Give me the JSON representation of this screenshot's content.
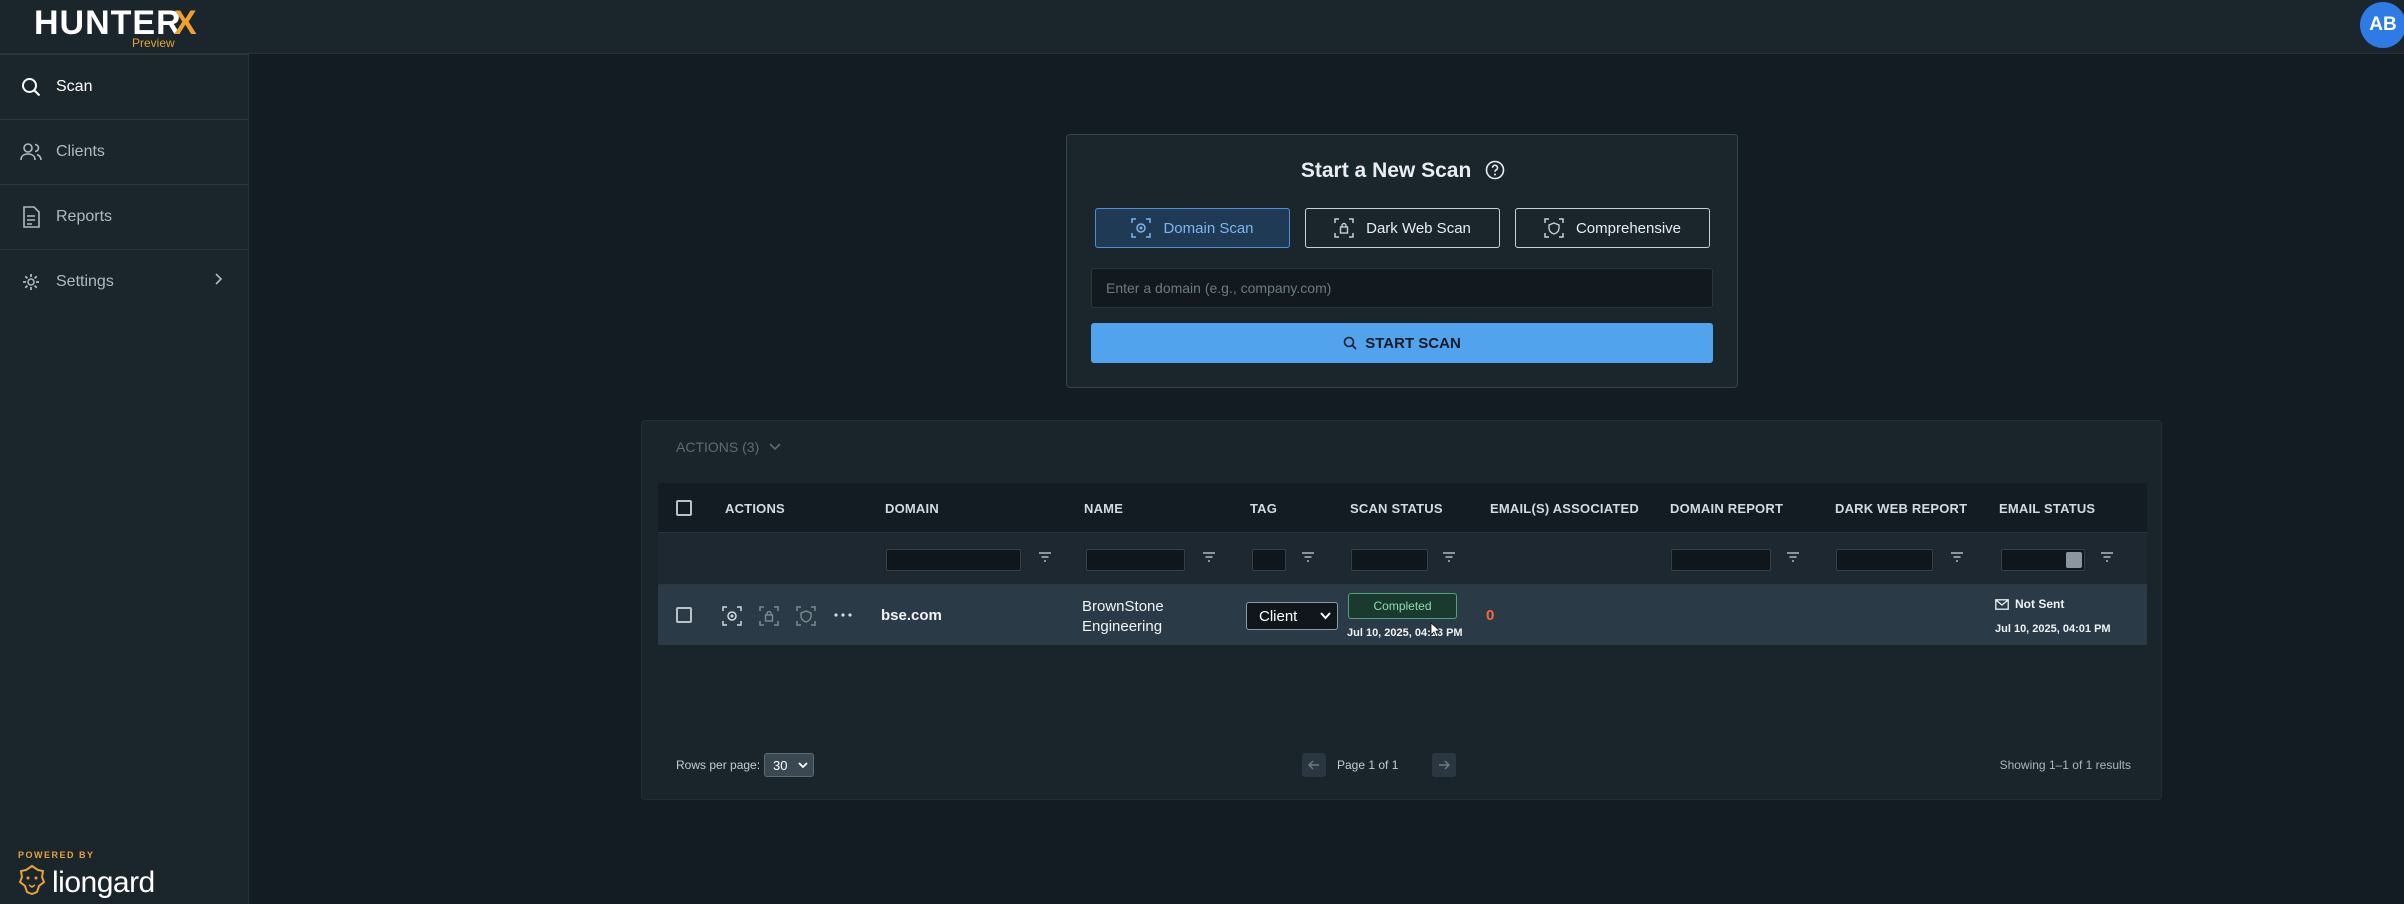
{
  "app": {
    "logo_text": "HUNTER",
    "logo_x": "X",
    "logo_badge": "Preview",
    "user_initials": "AB",
    "brand_accent": "#f0a030"
  },
  "sidebar": {
    "items": [
      {
        "label": "Scan",
        "icon": "search-icon",
        "active": true
      },
      {
        "label": "Clients",
        "icon": "users-icon"
      },
      {
        "label": "Reports",
        "icon": "document-icon"
      },
      {
        "label": "Settings",
        "icon": "gear-icon"
      }
    ],
    "powered_by": "POWERED BY",
    "partner": "liongard"
  },
  "scan_card": {
    "title": "Start a New Scan",
    "types": [
      {
        "label": "Domain Scan",
        "selected": true
      },
      {
        "label": "Dark Web Scan"
      },
      {
        "label": "Comprehensive"
      }
    ],
    "domain_placeholder": "Enter a domain (e.g., company.com)",
    "start_label": "START SCAN"
  },
  "table": {
    "actions_label": "ACTIONS (3)",
    "columns": [
      "ACTIONS",
      "DOMAIN",
      "NAME",
      "TAG",
      "SCAN STATUS",
      "EMAIL(S) ASSOCIATED",
      "DOMAIN REPORT",
      "DARK WEB REPORT",
      "EMAIL STATUS"
    ],
    "rows": [
      {
        "domain": "bse.com",
        "name": "BrownStone Engineering",
        "tag": "Client",
        "scan_status": "Completed",
        "scan_time": "Jul 10, 2025, 04:13 PM",
        "emails": "0",
        "email_status": "Not Sent",
        "email_time": "Jul 10, 2025, 04:01 PM"
      }
    ],
    "rows_per_page_label": "Rows per page:",
    "rows_per_page": "30",
    "page_text": "Page 1 of 1",
    "showing_text": "Showing 1–1 of 1 results"
  }
}
